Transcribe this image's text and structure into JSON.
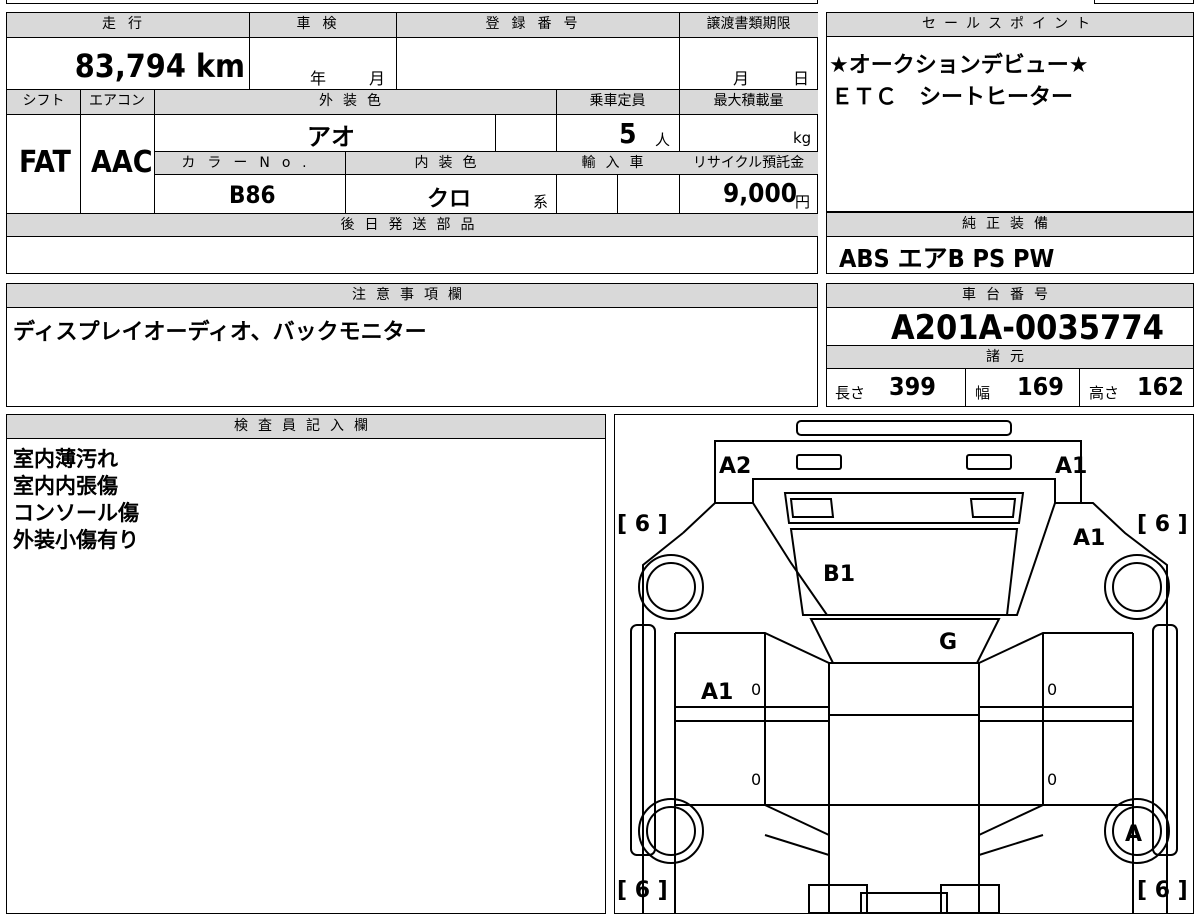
{
  "top": {
    "mileage_label": "走行",
    "mileage_value": "83,794 km",
    "shaken_label": "車検",
    "shaken_year": "年",
    "shaken_month": "月",
    "reg_label": "登録番号",
    "transfer_label": "譲渡書類期限",
    "transfer_month": "月",
    "transfer_day": "日"
  },
  "row2": {
    "shift_label": "シフト",
    "shift_value": "FAT",
    "ac_label": "エアコン",
    "ac_value": "AAC",
    "exterior_label": "外装色",
    "exterior_value": "アオ",
    "capacity_label": "乗車定員",
    "capacity_value": "5",
    "capacity_unit": "人",
    "maxload_label": "最大積載量",
    "maxload_unit": "kg",
    "color_no_label": "カラーNo.",
    "color_no_value": "B86",
    "interior_label": "内装色",
    "interior_value": "クロ",
    "interior_unit": "系",
    "import_label": "輸入車",
    "recycle_label": "リサイクル預託金",
    "recycle_value": "9,000",
    "recycle_unit": "円",
    "later_parts_label": "後日発送部品"
  },
  "sales": {
    "label": "セールスポイント",
    "line1": "★オークションデビュー★",
    "line2": "ＥＴＣ　シートヒーター"
  },
  "equipment": {
    "label": "純正装備",
    "value": "ABS エアB PS PW"
  },
  "notes": {
    "label": "注意事項欄",
    "text": "ディスプレイオーディオ、バックモニター"
  },
  "chassis": {
    "label": "車台番号",
    "value": "A201A-0035774",
    "spec_label": "諸元",
    "length_label": "長さ",
    "length_value": "399",
    "width_label": "幅",
    "width_value": "169",
    "height_label": "高さ",
    "height_value": "162"
  },
  "inspector": {
    "label": "検査員記入欄",
    "lines": [
      "室内薄汚れ",
      "室内内張傷",
      "コンソール傷",
      "外装小傷有り"
    ]
  },
  "diagram": {
    "marks": {
      "front_left_corner": "A2",
      "front_right_corner": "A1",
      "right_fender": "A1",
      "windshield": "B1",
      "roof": "G",
      "left_door": "A1",
      "rear_right_tire": "A"
    },
    "tire_left_front": "[ 6 ]",
    "tire_right_front": "[ 6 ]",
    "tire_left_rear": "[ 6 ]",
    "tire_right_rear": "[ 6 ]",
    "door_zero_a": "0",
    "door_zero_b": "0",
    "door_zero_c": "0",
    "door_zero_d": "0"
  }
}
